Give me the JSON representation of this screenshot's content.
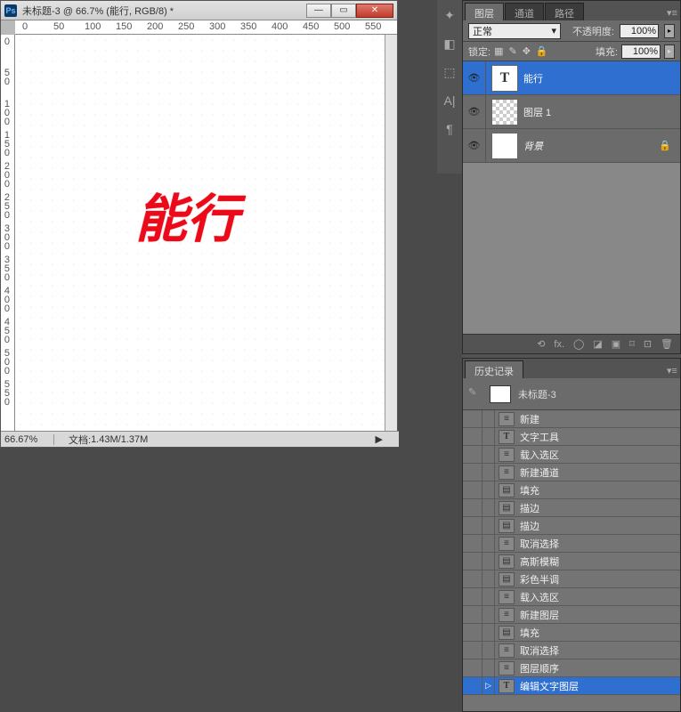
{
  "doc": {
    "title": "未标题-3 @ 66.7% (能行, RGB/8) *",
    "zoom": "66.67%",
    "info_label": "文档:",
    "info": "1.43M/1.37M",
    "canvas_text": "能行"
  },
  "ruler_h": [
    "0",
    "50",
    "100",
    "150",
    "200",
    "250",
    "300",
    "350",
    "400",
    "450",
    "500",
    "550"
  ],
  "ruler_v": [
    "0",
    "50",
    "100",
    "150",
    "200",
    "250",
    "300",
    "350",
    "400",
    "450",
    "500",
    "550"
  ],
  "layers_panel": {
    "tabs": [
      "图层",
      "通道",
      "路径"
    ],
    "blend_mode": "正常",
    "opacity_label": "不透明度:",
    "opacity_value": "100%",
    "lock_label": "锁定:",
    "fill_label": "填充:",
    "fill_value": "100%",
    "layers": [
      {
        "type": "T",
        "name": "能行",
        "selected": true
      },
      {
        "type": "checker",
        "name": "图层 1",
        "selected": false
      },
      {
        "type": "white",
        "name": "背景",
        "selected": false,
        "locked": true,
        "italic": true
      }
    ],
    "footer_icons": [
      "⟲",
      "fx.",
      "◯",
      "◪",
      "▣",
      "⌑",
      "⊡",
      "🗑"
    ]
  },
  "history_panel": {
    "title": "历史记录",
    "doc_name": "未标题-3",
    "items": [
      {
        "icon": "≡",
        "label": "新建"
      },
      {
        "icon": "T",
        "label": "文字工具"
      },
      {
        "icon": "≡",
        "label": "载入选区"
      },
      {
        "icon": "≡",
        "label": "新建通道"
      },
      {
        "icon": "▤",
        "label": "填充"
      },
      {
        "icon": "▤",
        "label": "描边"
      },
      {
        "icon": "▤",
        "label": "描边"
      },
      {
        "icon": "≡",
        "label": "取消选择"
      },
      {
        "icon": "▤",
        "label": "高斯模糊"
      },
      {
        "icon": "▤",
        "label": "彩色半调"
      },
      {
        "icon": "≡",
        "label": "载入选区"
      },
      {
        "icon": "≡",
        "label": "新建图层"
      },
      {
        "icon": "▤",
        "label": "填充"
      },
      {
        "icon": "≡",
        "label": "取消选择"
      },
      {
        "icon": "≡",
        "label": "图层顺序"
      },
      {
        "icon": "T",
        "label": "编辑文字图层",
        "selected": true,
        "marker": "▷"
      }
    ]
  }
}
